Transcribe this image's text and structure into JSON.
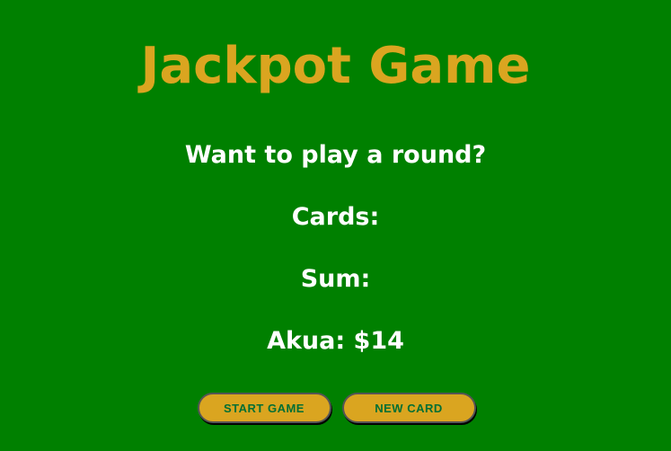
{
  "title": "Jackpot Game",
  "message": "Want to play a round?",
  "cards_label": "Cards:",
  "sum_label": "Sum:",
  "player": "Akua: $14",
  "buttons": {
    "start": "START GAME",
    "new_card": "NEW CARD"
  },
  "colors": {
    "background": "#008000",
    "accent": "#DAA520"
  }
}
